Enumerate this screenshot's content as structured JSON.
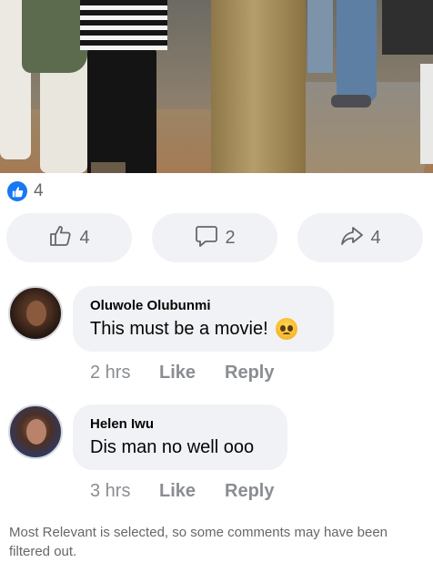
{
  "post": {
    "reactions": {
      "icon": "thumbs-up-icon",
      "count": "4",
      "color": "#1877f2"
    },
    "actions": [
      {
        "name": "like",
        "icon": "thumbs-up-outline-icon",
        "count": "4"
      },
      {
        "name": "comment",
        "icon": "comment-bubble-icon",
        "count": "2"
      },
      {
        "name": "share",
        "icon": "share-arrow-icon",
        "count": "4"
      }
    ]
  },
  "comments": [
    {
      "author": "Oluwole Olubunmi",
      "text": "This must be a movie!",
      "emoji": "pleading-face-emoji",
      "time": "2 hrs",
      "like_label": "Like",
      "reply_label": "Reply"
    },
    {
      "author": "Helen Iwu",
      "text": "Dis man no well ooo",
      "time": "3 hrs",
      "like_label": "Like",
      "reply_label": "Reply"
    }
  ],
  "footer": {
    "note": "Most Relevant is selected, so some comments may have been filtered out."
  }
}
